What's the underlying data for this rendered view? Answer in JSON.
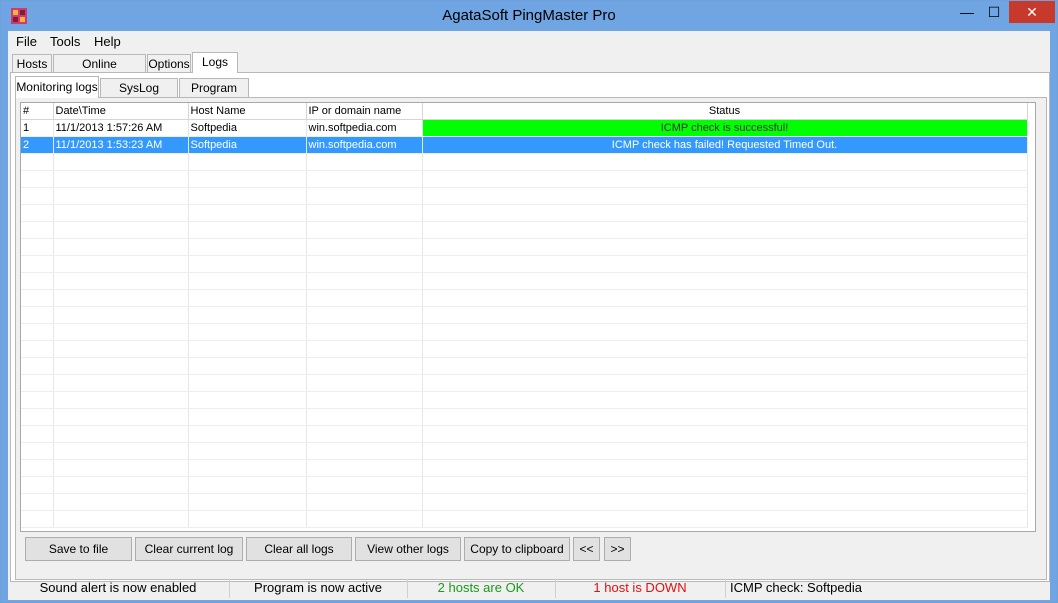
{
  "window": {
    "title": "AgataSoft PingMaster Pro",
    "minimize_glyph": "—",
    "maximize_glyph": "☐",
    "close_glyph": "✕"
  },
  "menu": [
    "File",
    "Tools",
    "Help"
  ],
  "main_tabs": [
    "Hosts",
    "Online monitoring",
    "Options",
    "Logs"
  ],
  "sub_tabs": [
    "Monitoring logs",
    "SysLog server",
    "Program logs"
  ],
  "table": {
    "columns": [
      "#",
      "Date\\Time",
      "Host Name",
      "IP or domain name",
      "Status"
    ],
    "rows": [
      {
        "num": "1",
        "datetime": "11/1/2013 1:57:26 AM",
        "host": "Softpedia",
        "ip": "win.softpedia.com",
        "status": "ICMP check is successful!"
      },
      {
        "num": "2",
        "datetime": "11/1/2013 1:53:23 AM",
        "host": "Softpedia",
        "ip": "win.softpedia.com",
        "status": "ICMP check has failed! Requested Timed Out."
      }
    ]
  },
  "buttons": {
    "save": "Save to file",
    "clear_current": "Clear current log",
    "clear_all": "Clear all logs",
    "view_other": "View other logs",
    "copy": "Copy to clipboard",
    "prev": "<<",
    "next": ">>"
  },
  "statusbar": {
    "sound": "Sound alert is now enabled",
    "program": "Program is now active",
    "hosts_ok": "2 hosts are OK",
    "hosts_down": "1 host is DOWN",
    "icmp": "ICMP check: Softpedia"
  },
  "colors": {
    "titlebar": "#6fa5e3",
    "close": "#c7392b",
    "status_ok": "#00ff00",
    "selection": "#3399ff",
    "ok_text": "#1a9a1a",
    "down_text": "#e01010"
  }
}
